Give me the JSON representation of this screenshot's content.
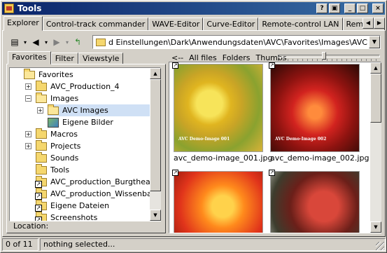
{
  "window": {
    "title": "Tools"
  },
  "title_controls": {
    "help": "?",
    "restore": "▣",
    "minimize": "_",
    "maximize": "□",
    "close": "×"
  },
  "tabs": [
    {
      "label": "Explorer"
    },
    {
      "label": "Control-track commander"
    },
    {
      "label": "WAVE-Editor"
    },
    {
      "label": "Curve-Editor"
    },
    {
      "label": "Remote-control LAN"
    },
    {
      "label": "Remote-control"
    }
  ],
  "tab_scroll": {
    "left": "◀",
    "right": "▶"
  },
  "toolbar": {
    "icons": [
      "details-icon",
      "back-arrow-icon",
      "forward-arrow-icon",
      "up-folder-icon"
    ],
    "path": "d Einstellungen\\Dark\\Anwendungsdaten\\AVC\\Favorites\\Images\\AVC Images",
    "dropdown": "▼"
  },
  "left_tabs": [
    "Favorites",
    "Filter",
    "Viewstyle"
  ],
  "tree": [
    {
      "label": "Favorites",
      "icon": "folder-open",
      "expander": "",
      "level": 0
    },
    {
      "label": "AVC_Production_4",
      "icon": "folder",
      "expander": "+",
      "level": 1
    },
    {
      "label": "Images",
      "icon": "folder-open",
      "expander": "−",
      "level": 1
    },
    {
      "label": "AVC Images",
      "icon": "folder-open",
      "expander": "+",
      "level": 2,
      "selected": true
    },
    {
      "label": "Eigene Bilder",
      "icon": "picture-folder",
      "expander": "",
      "level": 2
    },
    {
      "label": "Macros",
      "icon": "folder",
      "expander": "+",
      "level": 1
    },
    {
      "label": "Projects",
      "icon": "folder",
      "expander": "+",
      "level": 1
    },
    {
      "label": "Sounds",
      "icon": "folder",
      "expander": "",
      "level": 1
    },
    {
      "label": "Tools",
      "icon": "folder",
      "expander": "",
      "level": 1
    },
    {
      "label": "AVC_production_Burgtheater",
      "icon": "folder-link",
      "expander": "",
      "level": 1
    },
    {
      "label": "AVC_production_Wissenbach",
      "icon": "folder-link",
      "expander": "",
      "level": 1
    },
    {
      "label": "Eigene Dateien",
      "icon": "folder-link",
      "expander": "",
      "level": 1
    },
    {
      "label": "Screenshots",
      "icon": "folder-link",
      "expander": "",
      "level": 1
    }
  ],
  "location": {
    "label": "Location:"
  },
  "view_toolbar": {
    "back": "<--",
    "all_files": "All files",
    "folders": "Folders",
    "thumbs": "Thumbs",
    "thumb_size_level": 0.45
  },
  "thumbnails": [
    {
      "caption": "avc_demo-image_001.jpg",
      "watermark": "AVC Demo-Image 001"
    },
    {
      "caption": "avc_demo-image_002.jpg",
      "watermark": "AVC Demo-Image 002"
    },
    {
      "caption": "",
      "watermark": ""
    },
    {
      "caption": "",
      "watermark": ""
    }
  ],
  "scroll_arrows": {
    "up": "▲",
    "down": "▼"
  },
  "status": {
    "count": "0 of 11",
    "message": "nothing selected..."
  }
}
